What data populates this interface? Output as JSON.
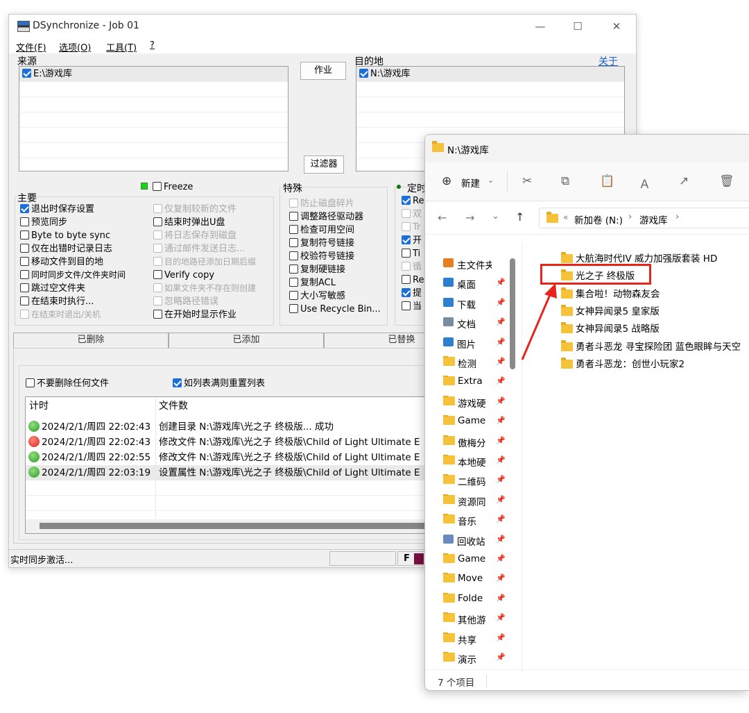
{
  "ds": {
    "title": "DSynchronize - Job 01",
    "menu": [
      "文件(F)",
      "选项(O)",
      "工具(T)",
      "?"
    ],
    "source_label": "来源",
    "dest_label": "目的地",
    "about_link": "关于",
    "source_item": "E:\\游戏库",
    "dest_item": "N:\\游戏库",
    "job_button": "作业",
    "filter_button": "过滤器",
    "freeze_label": "Freeze",
    "main_group": "主要",
    "special_group": "特殊",
    "scheduled_group": "定时",
    "main_options_col1": [
      {
        "label": "退出时保存设置",
        "checked": true,
        "enabled": true
      },
      {
        "label": "预览同步",
        "checked": false,
        "enabled": true
      },
      {
        "label": "Byte to byte sync",
        "checked": false,
        "enabled": true
      },
      {
        "label": "仅在出错时记录日志",
        "checked": false,
        "enabled": true
      },
      {
        "label": "移动文件到目的地",
        "checked": false,
        "enabled": true
      },
      {
        "label": "同时同步文件/文件夹时间",
        "checked": false,
        "enabled": true
      },
      {
        "label": "跳过空文件夹",
        "checked": false,
        "enabled": true
      },
      {
        "label": "在结束时执行...",
        "checked": false,
        "enabled": true
      },
      {
        "label": "在结束时退出/关机",
        "checked": false,
        "enabled": false
      }
    ],
    "main_options_col2": [
      {
        "label": "仅复制较新的文件",
        "checked": false,
        "enabled": false
      },
      {
        "label": "结束时弹出U盘",
        "checked": false,
        "enabled": true
      },
      {
        "label": "将日志保存到磁盘",
        "checked": false,
        "enabled": false
      },
      {
        "label": "通过邮件发送日志...",
        "checked": false,
        "enabled": false
      },
      {
        "label": "目的地路径添加日期后缀",
        "checked": false,
        "enabled": false
      },
      {
        "label": "Verify copy",
        "checked": false,
        "enabled": true
      },
      {
        "label": "如果文件夹不存在则创建",
        "checked": false,
        "enabled": false
      },
      {
        "label": "忽略路径错误",
        "checked": false,
        "enabled": false
      },
      {
        "label": "在开始时显示作业",
        "checked": false,
        "enabled": true
      }
    ],
    "special_options": [
      {
        "label": "防止磁盘碎片",
        "checked": false,
        "enabled": false
      },
      {
        "label": "调整路径驱动器",
        "checked": false,
        "enabled": true
      },
      {
        "label": "检查可用空间",
        "checked": false,
        "enabled": true
      },
      {
        "label": "复制符号链接",
        "checked": false,
        "enabled": true
      },
      {
        "label": "校验符号链接",
        "checked": false,
        "enabled": true
      },
      {
        "label": "复制硬链接",
        "checked": false,
        "enabled": true
      },
      {
        "label": "复制ACL",
        "checked": false,
        "enabled": true
      },
      {
        "label": "大小写敏感",
        "checked": false,
        "enabled": true
      },
      {
        "label": "Use Recycle Bin...",
        "checked": false,
        "enabled": true
      }
    ],
    "scheduled_options": [
      {
        "label": "Re",
        "checked": true,
        "enabled": true
      },
      {
        "label": "双",
        "checked": false,
        "enabled": false
      },
      {
        "label": "Tr",
        "checked": false,
        "enabled": false
      },
      {
        "label": "开",
        "checked": true,
        "enabled": true
      },
      {
        "label": "Ti",
        "checked": false,
        "enabled": true
      },
      {
        "label": "循",
        "checked": false,
        "enabled": false
      },
      {
        "label": "Re",
        "checked": false,
        "enabled": true
      },
      {
        "label": "提",
        "checked": true,
        "enabled": true
      },
      {
        "label": "当",
        "checked": false,
        "enabled": true
      }
    ],
    "tabs": [
      "已删除",
      "已添加",
      "已替换"
    ],
    "no_delete_label": "不要删除任何文件",
    "reset_list_label": "如列表满则重置列表",
    "log_headers": [
      "计时",
      "文件数"
    ],
    "log_rows": [
      {
        "status": "ok",
        "time": "2024/2/1/周四 22:02:43",
        "text": "创建目录 N:\\游戏库\\光之子 终极版... 成功"
      },
      {
        "status": "error",
        "time": "2024/2/1/周四 22:02:43",
        "text": "修改文件 N:\\游戏库\\光之子 终极版\\Child of Light Ultimate E"
      },
      {
        "status": "ok",
        "time": "2024/2/1/周四 22:02:55",
        "text": "修改文件 N:\\游戏库\\光之子 终极版\\Child of Light Ultimate E"
      },
      {
        "status": "ok",
        "time": "2024/2/1/周四 22:03:19",
        "text": "设置属性 N:\\游戏库\\光之子 终极版\\Child of Light Ultimate E"
      }
    ],
    "status_text": "实时同步激活...",
    "status_f": "F"
  },
  "explorer": {
    "title": "N:\\游戏库",
    "new_button": "新建",
    "breadcrumb_prefix": "«",
    "breadcrumb": [
      "新加卷 (N:)",
      "游戏库"
    ],
    "sidebar": [
      {
        "label": "主文件夹",
        "icon": "home-icon",
        "pinned": false
      },
      {
        "label": "桌面",
        "icon": "desktop-icon",
        "pinned": true
      },
      {
        "label": "下载",
        "icon": "download-icon",
        "pinned": true
      },
      {
        "label": "文档",
        "icon": "document-icon",
        "pinned": true
      },
      {
        "label": "图片",
        "icon": "picture-icon",
        "pinned": true
      },
      {
        "label": "检测",
        "icon": "folder-icon",
        "pinned": true
      },
      {
        "label": "Extra",
        "icon": "folder-icon",
        "pinned": true
      },
      {
        "label": "游戏硬",
        "icon": "folder-icon",
        "pinned": true
      },
      {
        "label": "Game",
        "icon": "folder-icon",
        "pinned": true
      },
      {
        "label": "傲梅分",
        "icon": "folder-icon",
        "pinned": true
      },
      {
        "label": "本地硬",
        "icon": "folder-icon",
        "pinned": true
      },
      {
        "label": "二维码",
        "icon": "folder-icon",
        "pinned": true
      },
      {
        "label": "资源同",
        "icon": "folder-icon",
        "pinned": true
      },
      {
        "label": "音乐",
        "icon": "folder-icon",
        "pinned": true
      },
      {
        "label": "回收站",
        "icon": "recycle-bin-icon",
        "pinned": true
      },
      {
        "label": "Game",
        "icon": "folder-icon",
        "pinned": true
      },
      {
        "label": "Move",
        "icon": "folder-icon",
        "pinned": true
      },
      {
        "label": "Folde",
        "icon": "folder-icon",
        "pinned": true
      },
      {
        "label": "其他游",
        "icon": "folder-icon",
        "pinned": true
      },
      {
        "label": "共享",
        "icon": "folder-icon",
        "pinned": true
      },
      {
        "label": "演示",
        "icon": "folder-icon",
        "pinned": true
      }
    ],
    "items": [
      "大航海时代IV 威力加强版套装 HD",
      "光之子 终极版",
      "集合啦！动物森友会",
      "女神异闻录5 皇家版",
      "女神异闻录5 战略版",
      "勇者斗恶龙 寻宝探险团 蓝色眼眸与天空",
      "勇者斗恶龙：创世小玩家2"
    ],
    "highlighted_item": "光之子 终极版",
    "item_count": "7 个项目",
    "highlight_color": "#e8231a"
  }
}
